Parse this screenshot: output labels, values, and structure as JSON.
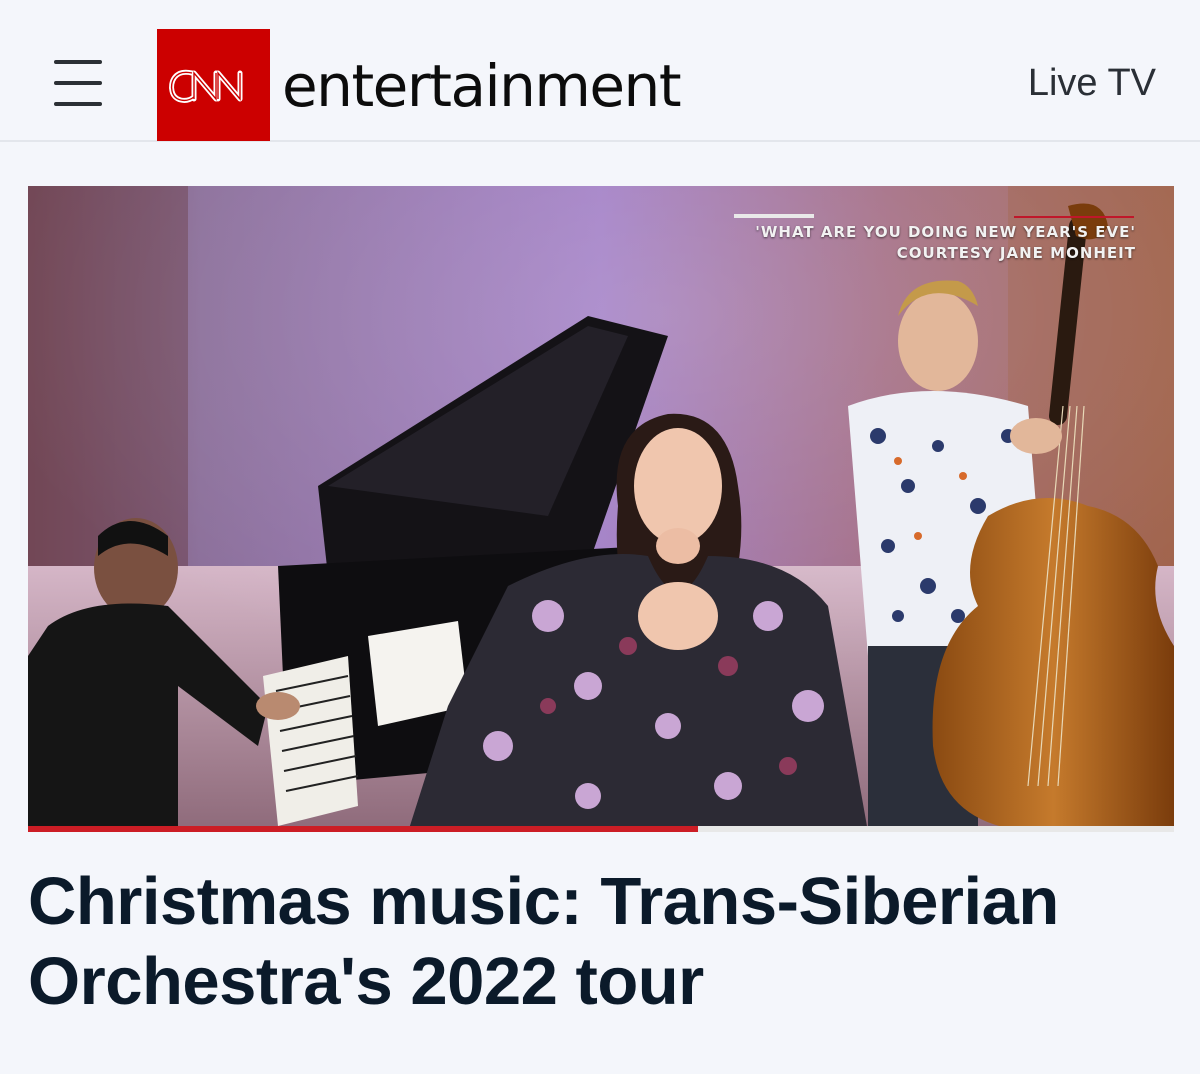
{
  "header": {
    "menu_icon": "hamburger-menu-icon",
    "logo_text": "CNN",
    "section_word": "entertainment",
    "live_tv_label": "Live TV",
    "brand_color": "#cc0000"
  },
  "video": {
    "caption_line1": "'WHAT ARE YOU DOING NEW YEAR'S EVE'",
    "caption_line2": "COURTESY JANE MONHEIT",
    "progress_fraction": 0.585,
    "progress_color": "#cc1d25"
  },
  "article": {
    "headline": "Christmas music: Trans-Siberian Orchestra's 2022 tour"
  }
}
